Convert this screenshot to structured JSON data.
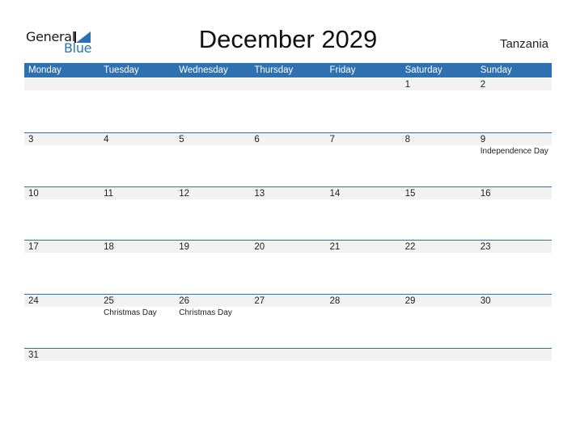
{
  "logo": {
    "general": "General",
    "blue": "Blue",
    "icon": "triangle-flag-icon"
  },
  "title": "December 2029",
  "country": "Tanzania",
  "colors": {
    "accent": "#2e70b0",
    "strip": "#f2f2f2",
    "logo_blue": "#2a72b5"
  },
  "weekdays": [
    "Monday",
    "Tuesday",
    "Wednesday",
    "Thursday",
    "Friday",
    "Saturday",
    "Sunday"
  ],
  "weeks": [
    {
      "days": [
        {
          "num": "",
          "holiday": ""
        },
        {
          "num": "",
          "holiday": ""
        },
        {
          "num": "",
          "holiday": ""
        },
        {
          "num": "",
          "holiday": ""
        },
        {
          "num": "",
          "holiday": ""
        },
        {
          "num": "1",
          "holiday": ""
        },
        {
          "num": "2",
          "holiday": ""
        }
      ]
    },
    {
      "days": [
        {
          "num": "3",
          "holiday": ""
        },
        {
          "num": "4",
          "holiday": ""
        },
        {
          "num": "5",
          "holiday": ""
        },
        {
          "num": "6",
          "holiday": ""
        },
        {
          "num": "7",
          "holiday": ""
        },
        {
          "num": "8",
          "holiday": ""
        },
        {
          "num": "9",
          "holiday": "Independence Day"
        }
      ]
    },
    {
      "days": [
        {
          "num": "10",
          "holiday": ""
        },
        {
          "num": "11",
          "holiday": ""
        },
        {
          "num": "12",
          "holiday": ""
        },
        {
          "num": "13",
          "holiday": ""
        },
        {
          "num": "14",
          "holiday": ""
        },
        {
          "num": "15",
          "holiday": ""
        },
        {
          "num": "16",
          "holiday": ""
        }
      ]
    },
    {
      "days": [
        {
          "num": "17",
          "holiday": ""
        },
        {
          "num": "18",
          "holiday": ""
        },
        {
          "num": "19",
          "holiday": ""
        },
        {
          "num": "20",
          "holiday": ""
        },
        {
          "num": "21",
          "holiday": ""
        },
        {
          "num": "22",
          "holiday": ""
        },
        {
          "num": "23",
          "holiday": ""
        }
      ]
    },
    {
      "days": [
        {
          "num": "24",
          "holiday": ""
        },
        {
          "num": "25",
          "holiday": "Christmas Day"
        },
        {
          "num": "26",
          "holiday": "Christmas Day"
        },
        {
          "num": "27",
          "holiday": ""
        },
        {
          "num": "28",
          "holiday": ""
        },
        {
          "num": "29",
          "holiday": ""
        },
        {
          "num": "30",
          "holiday": ""
        }
      ]
    },
    {
      "days": [
        {
          "num": "31",
          "holiday": ""
        },
        {
          "num": "",
          "holiday": ""
        },
        {
          "num": "",
          "holiday": ""
        },
        {
          "num": "",
          "holiday": ""
        },
        {
          "num": "",
          "holiday": ""
        },
        {
          "num": "",
          "holiday": ""
        },
        {
          "num": "",
          "holiday": ""
        }
      ]
    }
  ]
}
